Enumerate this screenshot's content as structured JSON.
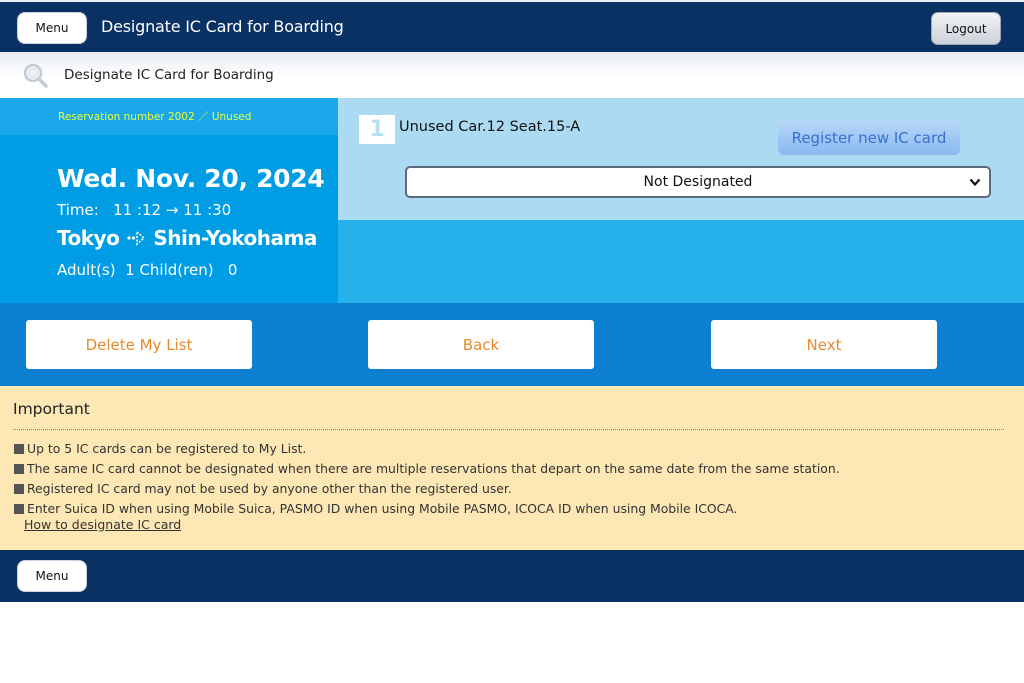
{
  "header": {
    "menu_label": "Menu",
    "title": "Designate IC Card for Boarding",
    "logout_label": "Logout"
  },
  "subheader": {
    "icon": "search-icon",
    "title": "Designate IC Card for Boarding"
  },
  "reservation": {
    "number_status": "Reservation number 2002 ／ Unused",
    "date": "Wed. Nov. 20, 2024",
    "time_label": "Time:",
    "time_from": "11 :12",
    "time_arrow": "→",
    "time_to": "11 :30",
    "from_station": "Tokyo",
    "to_station": "Shin-Yokohama",
    "passengers": "Adult(s)  1 Child(ren)   0"
  },
  "seat": {
    "index": "1",
    "info": "Unused Car.12 Seat.15-A",
    "register_label": "Register new IC card",
    "select_value": "Not Designated"
  },
  "actions": {
    "delete_label": "Delete My List",
    "back_label": "Back",
    "next_label": "Next"
  },
  "important": {
    "title": "Important",
    "items": [
      "Up to 5 IC cards can be registered to My List.",
      "The same IC card cannot be designated when there are multiple reservations that depart on the same date from the same station.",
      "Registered IC card may not be used by anyone other than the registered user.",
      "Enter Suica ID when using Mobile Suica, PASMO ID when using Mobile PASMO, ICOCA ID when using Mobile ICOCA."
    ],
    "link_label": "How to designate IC card"
  },
  "footer": {
    "menu_label": "Menu"
  },
  "colors": {
    "navy": "#0a3163",
    "blue": "#009de4",
    "light_blue": "#abdaf2",
    "button_row": "#0d80d1",
    "notice_bg": "#fde8b5",
    "action_text": "#e8892a",
    "reservation_text": "#e8ff3c"
  }
}
